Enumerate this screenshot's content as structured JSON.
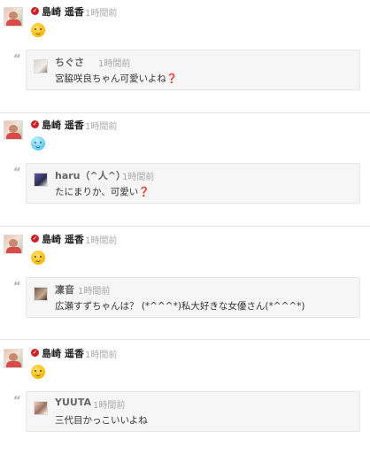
{
  "posts": [
    {
      "author": "島崎 遥香",
      "time": "1時間前",
      "emoji": "slightly-smiling-face",
      "comment": {
        "author": "ちぐさ",
        "time": "1時間前",
        "text": "宮脇咲良ちゃん可愛いよね❓"
      }
    },
    {
      "author": "島崎 遥香",
      "time": "1時間前",
      "emoji": "face-with-open-mouth-cold",
      "comment": {
        "author": "haru（^人^）",
        "time": "1時間前",
        "text": "たにまりか、可愛い❓"
      }
    },
    {
      "author": "島崎 遥香",
      "time": "1時間前",
      "emoji": "slightly-smiling-face",
      "comment": {
        "author": "凜音",
        "time": "1時間前",
        "text": "広瀬すずちゃんは？ (*^^^*)私大好きな女優さん(*^^^*)"
      }
    },
    {
      "author": "島崎 遥香",
      "time": "1時間前",
      "emoji": "slightly-smiling-face",
      "comment": {
        "author": "YUUTA",
        "time": "1時間前",
        "text": "三代目かっこいいよね"
      }
    }
  ],
  "colors": {
    "badge": "#cc2127",
    "time": "#a8a8a8",
    "comment_bg": "#f6f6f6",
    "divider": "#e4e4e4"
  },
  "icons": {
    "badge": "verified-badge-icon",
    "quote": "quote-icon"
  }
}
